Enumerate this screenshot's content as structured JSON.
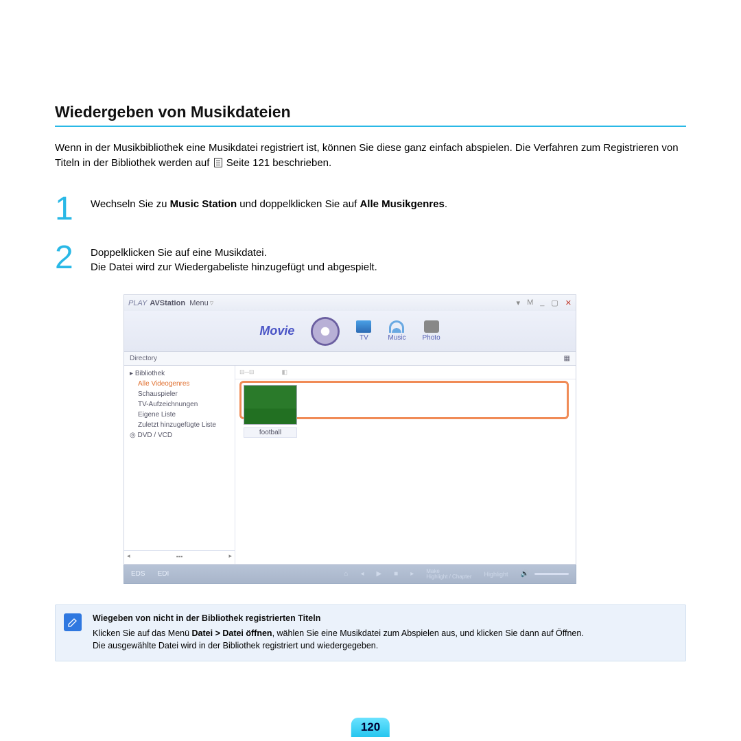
{
  "heading": "Wiedergeben von Musikdateien",
  "intro_a": "Wenn in der Musikbibliothek eine Musikdatei registriert ist, können Sie diese ganz einfach abspielen. Die Verfahren zum Registrieren von Titeln in der Bibliothek werden auf ",
  "intro_b": " Seite 121 beschrieben.",
  "step1_a": "Wechseln Sie zu ",
  "step1_b": "Music Station",
  "step1_c": " und doppelklicken Sie auf ",
  "step1_d": "Alle Musikgenres",
  "step1_e": ".",
  "step2_a": "Doppelklicken Sie auf eine Musikdatei.",
  "step2_b": "Die Datei wird zur Wiedergabeliste hinzugefügt und abgespielt.",
  "shot": {
    "app_prefix": "PLAY",
    "app_name": "AVStation",
    "menu": "Menu",
    "header_label": "Movie",
    "tabs": {
      "tv": "TV",
      "music": "Music",
      "photo": "Photo"
    },
    "dir_label": "Directory",
    "tree": {
      "root": "Bibliothek",
      "i1": "Alle Videogenres",
      "i2": "Schauspieler",
      "i3": "TV-Aufzeichnungen",
      "i4": "Eigene Liste",
      "i5": "Zuletzt hinzugefügte Liste",
      "dvd": "DVD / VCD"
    },
    "thumb_caption": "football",
    "footer": {
      "eds": "EDS",
      "edi": "EDI",
      "make": "Make",
      "hl_ch": "Highlight / Chapter",
      "hl": "Highlight"
    },
    "win_ctrls": {
      "m": "M",
      "min": "_",
      "max": "▢",
      "close": "✕",
      "thumb": "▾"
    }
  },
  "note": {
    "title": "Wiegeben von nicht in der Bibliothek registrierten Titeln",
    "line1_a": "Klicken Sie auf das Menü ",
    "line1_b": "Datei > Datei öffnen",
    "line1_c": ", wählen Sie eine Musikdatei zum Abspielen aus, und klicken Sie dann auf Öffnen.",
    "line2": "Die ausgewählte Datei wird in der Bibliothek registriert und wiedergegeben."
  },
  "page_number": "120"
}
